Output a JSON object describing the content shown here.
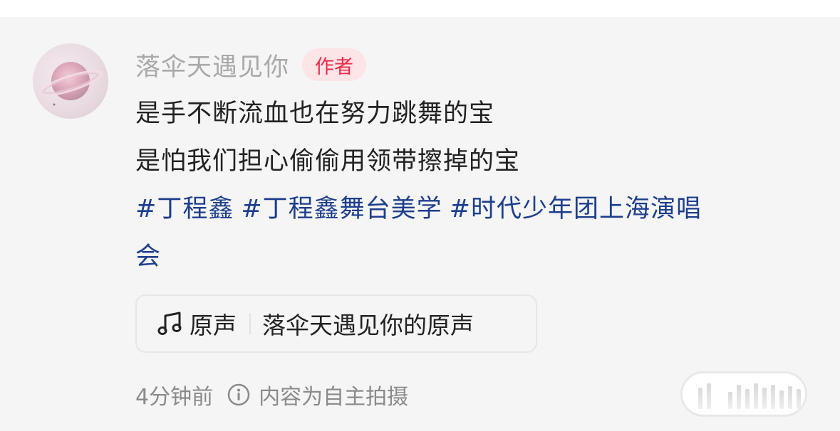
{
  "comment": {
    "username": "落伞天遇见你",
    "badge": "作者",
    "lines": [
      "是手不断流血也在努力跳舞的宝",
      "是怕我们担心偷偷用领带擦掉的宝"
    ],
    "hashtags": [
      "#丁程鑫",
      "#丁程鑫舞台美学",
      "#时代少年团上海演唱",
      "会"
    ],
    "sound": {
      "type": "原声",
      "title": "落伞天遇见你的原声",
      "icon": "music-note-icon"
    },
    "meta": {
      "time": "4分钟前",
      "info_icon": "info-circle-icon",
      "original_note": "内容为自主拍摄"
    }
  },
  "colors": {
    "background": "#f5f5f5",
    "username": "#a9a9a9",
    "badge_bg": "#fde4e6",
    "badge_text": "#ee2a4a",
    "body_text": "#222222",
    "hashtag": "#1c3e8c",
    "meta_text": "#8a8a8a"
  }
}
